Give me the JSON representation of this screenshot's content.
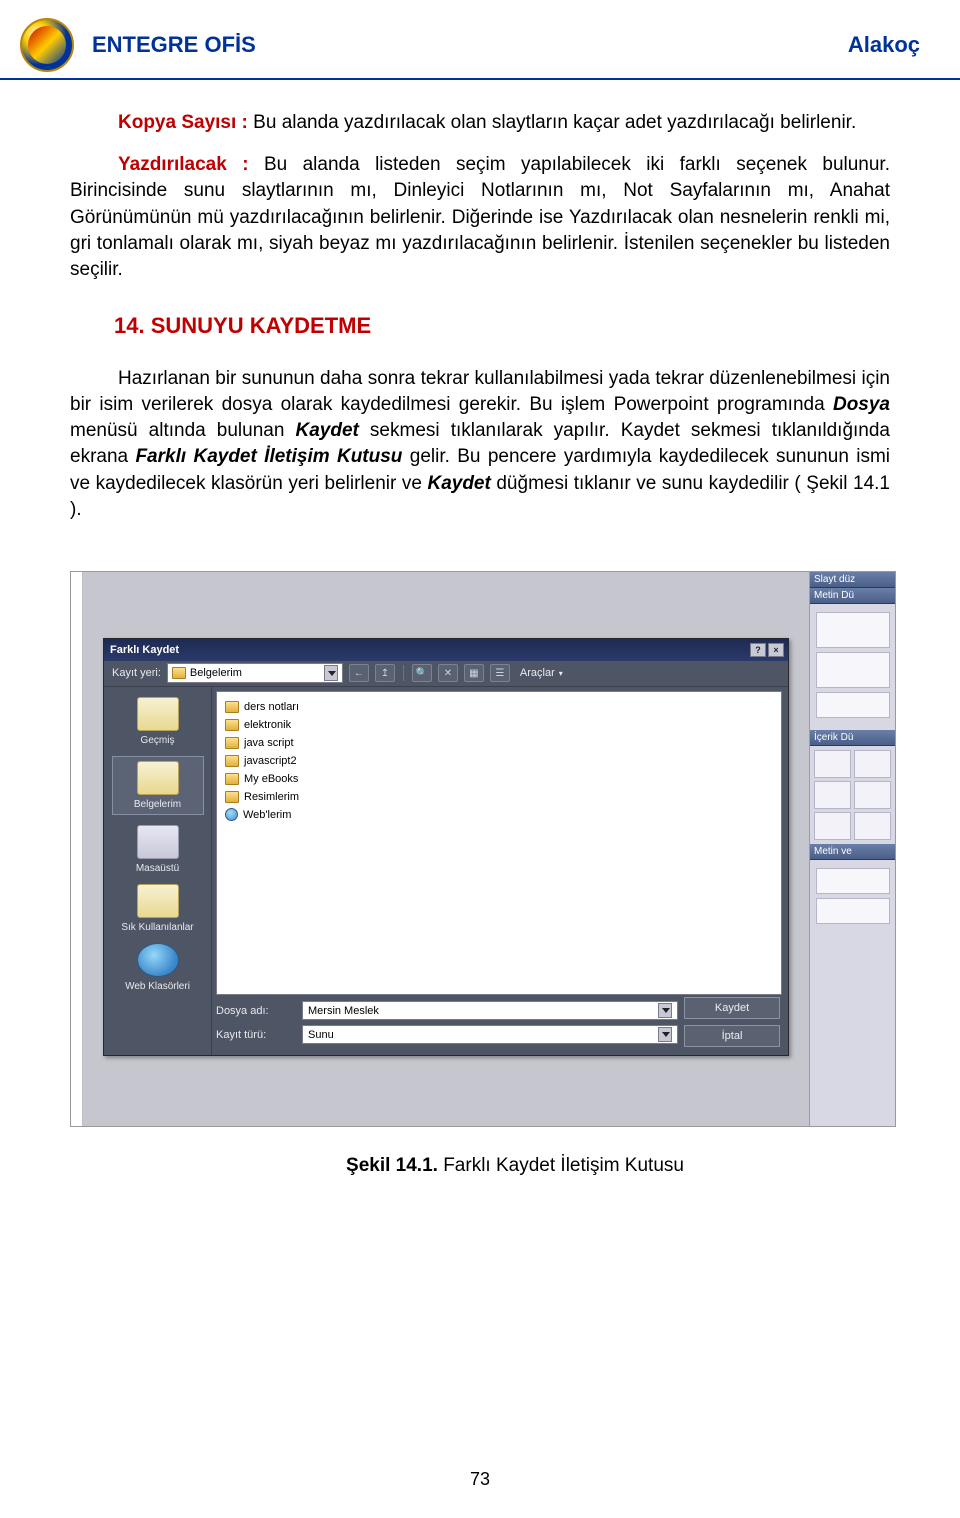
{
  "header": {
    "brand": "ENTEGRE OFİS",
    "author": "Alakoç"
  },
  "body": {
    "p1_label": "Kopya Sayısı : ",
    "p1_rest": "Bu alanda yazdırılacak olan slaytların kaçar adet yazdırılacağı belirlenir.",
    "p2_label": "Yazdırılacak : ",
    "p2_rest": "Bu alanda listeden seçim yapılabilecek iki farklı seçenek bulunur. Birincisinde sunu slaytlarının mı, Dinleyici Notlarının mı, Not Sayfalarının mı, Anahat Görünümünün mü yazdırılacağının belirlenir. Diğerinde ise Yazdırılacak olan nesnelerin renkli mi, gri tonlamalı olarak mı, siyah beyaz mı yazdırılacağının belirlenir. İstenilen seçenekler bu listeden seçilir.",
    "h2": "14.  SUNUYU KAYDETME",
    "p3a": "Hazırlanan bir sununun daha sonra tekrar kullanılabilmesi yada tekrar düzenlenebilmesi için bir isim verilerek dosya olarak kaydedilmesi gerekir. Bu işlem Powerpoint programında ",
    "p3_dosya": "Dosya",
    "p3b": " menüsü altında bulunan ",
    "p3_kaydet": "Kaydet",
    "p3c": " sekmesi tıklanılarak yapılır. ",
    "p3d": "Kaydet sekmesi tıklanıldığında ekrana ",
    "p3_dlg": "Farklı Kaydet İletişim Kutusu",
    "p3e": " gelir. Bu pencere yardımıyla kaydedilecek sununun ismi ve kaydedilecek klasörün yeri belirlenir ve ",
    "p3_kaydet2": "Kaydet",
    "p3f": " düğmesi tıklanır ve sunu kaydedilir ( Şekil 14.1 )."
  },
  "dialog": {
    "title": "Farklı Kaydet",
    "help": "?",
    "close": "×",
    "lookin_label": "Kayıt yeri:",
    "lookin_value": "Belgelerim",
    "tools_label": "Araçlar",
    "places": [
      "Geçmiş",
      "Belgelerim",
      "Masaüstü",
      "Sık Kullanılanlar",
      "Web Klasörleri"
    ],
    "files": [
      "ders notları",
      "elektronik",
      "java script",
      "javascript2",
      "My eBooks",
      "Resimlerim",
      "Web'lerim"
    ],
    "filename_label": "Dosya adı:",
    "filename_value": "Mersin Meslek",
    "filetype_label": "Kayıt türü:",
    "filetype_value": "Sunu",
    "save_btn": "Kaydet",
    "cancel_btn": "İptal"
  },
  "rightpane": {
    "l1": "Slayt düz",
    "l2": "Metin Dü",
    "l3": "İçerik Dü",
    "l4": "Metin ve"
  },
  "caption": {
    "bold": "Şekil 14.1.",
    "rest": " Farklı Kaydet İletişim Kutusu"
  },
  "page_number": "73"
}
